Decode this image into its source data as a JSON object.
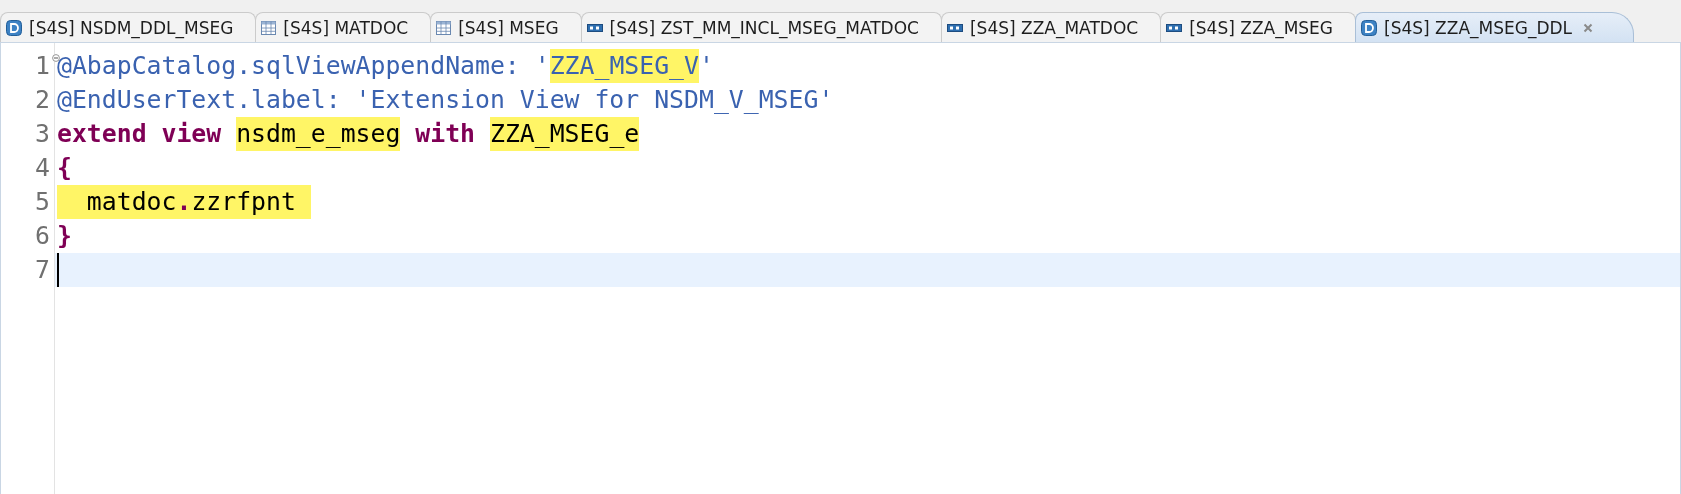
{
  "tabs": [
    {
      "label": "[S4S] NSDM_DDL_MSEG",
      "kind": "ddl",
      "selected": false
    },
    {
      "label": "[S4S] MATDOC",
      "kind": "table",
      "selected": false
    },
    {
      "label": "[S4S] MSEG",
      "kind": "table",
      "selected": false
    },
    {
      "label": "[S4S] ZST_MM_INCL_MSEG_MATDOC",
      "kind": "structure",
      "selected": false
    },
    {
      "label": "[S4S] ZZA_MATDOC",
      "kind": "structure",
      "selected": false
    },
    {
      "label": "[S4S] ZZA_MSEG",
      "kind": "structure",
      "selected": false
    },
    {
      "label": "[S4S] ZZA_MSEG_DDL",
      "kind": "ddl",
      "selected": true
    }
  ],
  "editor": {
    "lines": [
      {
        "number": "1",
        "foldable": true,
        "current": false,
        "tokens": [
          {
            "text": "@AbapCatalog.sqlViewAppendName: '",
            "kind": "annotation",
            "highlighted": false
          },
          {
            "text": "ZZA_MSEG_V",
            "kind": "string",
            "highlighted": true
          },
          {
            "text": "'",
            "kind": "annotation",
            "highlighted": false
          }
        ]
      },
      {
        "number": "2",
        "foldable": false,
        "current": false,
        "tokens": [
          {
            "text": "@EndUserText.label: 'Extension View for NSDM_V_MSEG'",
            "kind": "annotation",
            "highlighted": false
          }
        ]
      },
      {
        "number": "3",
        "foldable": false,
        "current": false,
        "tokens": [
          {
            "text": "extend view ",
            "kind": "keyword",
            "highlighted": false
          },
          {
            "text": "nsdm_e_mseg",
            "kind": "plain",
            "highlighted": true
          },
          {
            "text": " with ",
            "kind": "keyword",
            "highlighted": false
          },
          {
            "text": "ZZA_MSEG_e",
            "kind": "plain",
            "highlighted": true
          }
        ]
      },
      {
        "number": "4",
        "foldable": false,
        "current": false,
        "tokens": [
          {
            "text": "{",
            "kind": "keyword",
            "highlighted": false
          }
        ]
      },
      {
        "number": "5",
        "foldable": false,
        "current": false,
        "tokens": [
          {
            "text": "  matdoc",
            "kind": "plain",
            "highlighted": true
          },
          {
            "text": ".",
            "kind": "keyword",
            "highlighted": true
          },
          {
            "text": "zzrfpnt ",
            "kind": "plain",
            "highlighted": true
          }
        ]
      },
      {
        "number": "6",
        "foldable": false,
        "current": false,
        "tokens": [
          {
            "text": "}",
            "kind": "keyword",
            "highlighted": false
          }
        ]
      },
      {
        "number": "7",
        "foldable": false,
        "current": true
      }
    ]
  }
}
